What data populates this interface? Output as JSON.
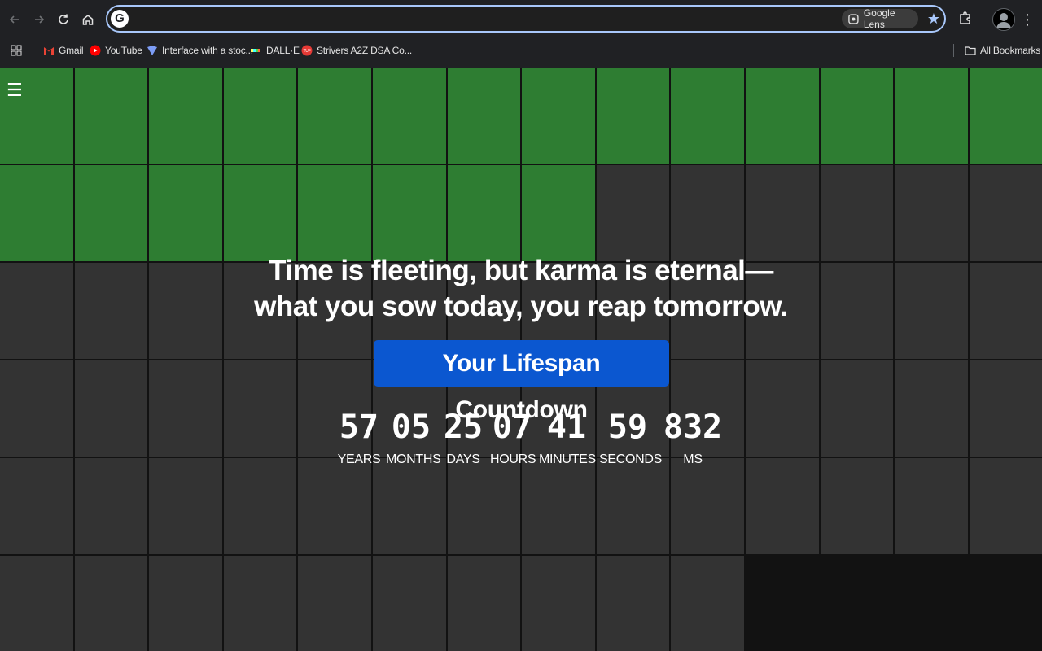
{
  "browser": {
    "omnibox_value": "",
    "lens_label": "Google Lens",
    "bookmarks": [
      {
        "label": "Gmail",
        "icon": "gmail-icon"
      },
      {
        "label": "YouTube",
        "icon": "youtube-icon"
      },
      {
        "label": "Interface with a stoc...",
        "icon": "interface-icon"
      },
      {
        "label": "DALL·E",
        "icon": "dalle-icon"
      },
      {
        "label": "Strivers A2Z DSA Co...",
        "icon": "tuf-icon"
      }
    ],
    "all_bookmarks_label": "All Bookmarks"
  },
  "page": {
    "menu_icon": "☰",
    "quote": "Time is fleeting, but karma is eternal— what you sow today, you reap tomorrow.",
    "cta_label": "Your Lifespan Countdown",
    "countdown": [
      {
        "value": "57",
        "label": "YEARS"
      },
      {
        "value": "05",
        "label": "MONTHS"
      },
      {
        "value": "25",
        "label": "DAYS"
      },
      {
        "value": "07",
        "label": "HOURS"
      },
      {
        "value": "41",
        "label": "MINUTES"
      },
      {
        "value": "59",
        "label": "SECONDS"
      },
      {
        "value": "832",
        "label": "MS"
      }
    ],
    "grid": {
      "lived_cells": 22,
      "total_cells": 80,
      "colors": {
        "lived": "#2e7d32",
        "remaining": "#333333",
        "background": "#121212"
      }
    }
  }
}
